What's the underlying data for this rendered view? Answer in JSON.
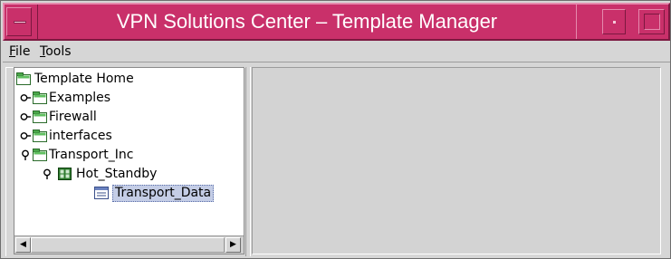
{
  "window": {
    "title": "VPN Solutions Center – Template Manager",
    "accent_color": "#c9306a"
  },
  "menubar": {
    "file": {
      "mnemonic": "F",
      "rest": "ile"
    },
    "tools": {
      "mnemonic": "T",
      "rest": "ools"
    }
  },
  "tree": {
    "nodes": [
      {
        "label": "Template Home",
        "icon": "folder-icon",
        "handle": "none"
      },
      {
        "label": "Examples",
        "icon": "folder-icon",
        "handle": "collapsed"
      },
      {
        "label": "Firewall",
        "icon": "folder-icon",
        "handle": "collapsed"
      },
      {
        "label": "interfaces",
        "icon": "folder-icon",
        "handle": "collapsed"
      },
      {
        "label": "Transport_Inc",
        "icon": "folder-icon",
        "handle": "expanded"
      },
      {
        "label": "Hot_Standby",
        "icon": "template-group-icon",
        "handle": "expanded"
      },
      {
        "label": "Transport_Data",
        "icon": "template-file-icon",
        "handle": "none",
        "selected": true
      }
    ]
  },
  "scrollbar": {
    "left_arrow": "◀",
    "right_arrow": "▶"
  }
}
